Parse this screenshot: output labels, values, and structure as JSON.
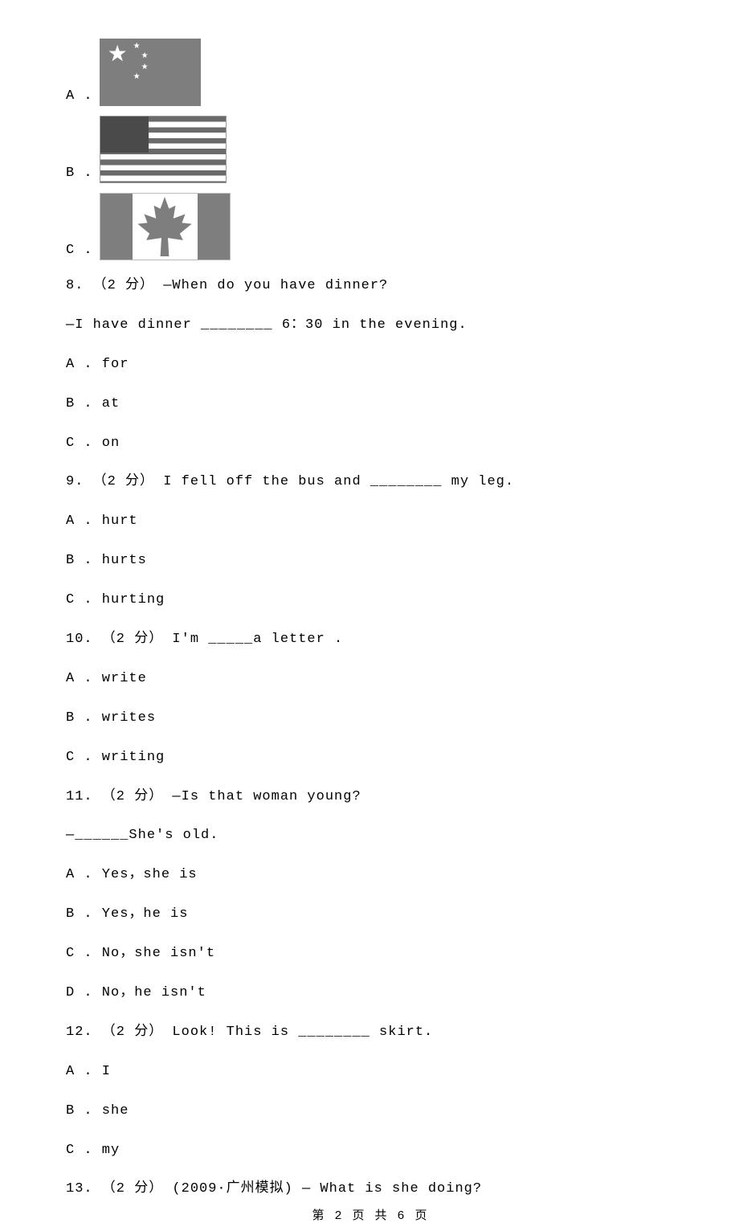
{
  "optA": "A .",
  "optB": "B .",
  "optC": "C .",
  "q8": {
    "line1": "8. （2 分） —When do you have dinner?",
    "line2": "—I have dinner ________ 6：30 in the evening.",
    "a": "A . for",
    "b": "B . at",
    "c": "C . on"
  },
  "q9": {
    "line1": "9. （2 分） I fell off the bus and ________ my leg.",
    "a": "A . hurt",
    "b": "B . hurts",
    "c": "C . hurting"
  },
  "q10": {
    "line1": "10. （2 分） I'm _____a letter .",
    "a": "A . write",
    "b": "B . writes",
    "c": "C . writing"
  },
  "q11": {
    "line1": "11. （2 分） —Is that woman young?",
    "line2": "—______She's old.",
    "a": "A . Yes，she is",
    "b": "B . Yes，he is",
    "c": "C . No，she isn't",
    "d": "D . No，he isn't"
  },
  "q12": {
    "line1": "12. （2 分） Look! This is ________ skirt.",
    "a": "A . I",
    "b": "B . she",
    "c": "C . my"
  },
  "q13": {
    "line1": "13. （2 分） (2009·广州模拟) — What is she doing?"
  },
  "footer": "第 2 页 共 6 页"
}
